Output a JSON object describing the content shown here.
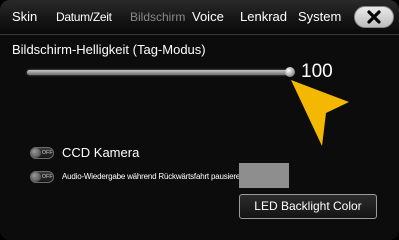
{
  "tabs": [
    {
      "label": "Skin"
    },
    {
      "label": "Datum/Zeit"
    },
    {
      "label": "Bildschirm",
      "selected": true
    },
    {
      "label": "Voice"
    },
    {
      "label": "Lenkrad"
    },
    {
      "label": "System"
    }
  ],
  "close_icon": "close-x-icon",
  "brightness": {
    "title": "Bildschirm-Helligkeit (Tag-Modus)",
    "value": 100,
    "value_text": "100",
    "min": 0,
    "max": 100
  },
  "pointer_icon": "yellow-arrow-pointer",
  "options": {
    "ccd": {
      "toggle_text": "OFF",
      "label": "CCD Kamera",
      "state": "off"
    },
    "audio": {
      "toggle_text": "OFF",
      "label": "Audio-Wiedergabe während Rückwärtsfahrt pausieren",
      "state": "off"
    }
  },
  "led_button": {
    "label": "LED Backlight Color"
  },
  "colors": {
    "accent_pointer": "#f5b800",
    "background": "#0c0c0c",
    "swatch": "#8e8e8e"
  }
}
